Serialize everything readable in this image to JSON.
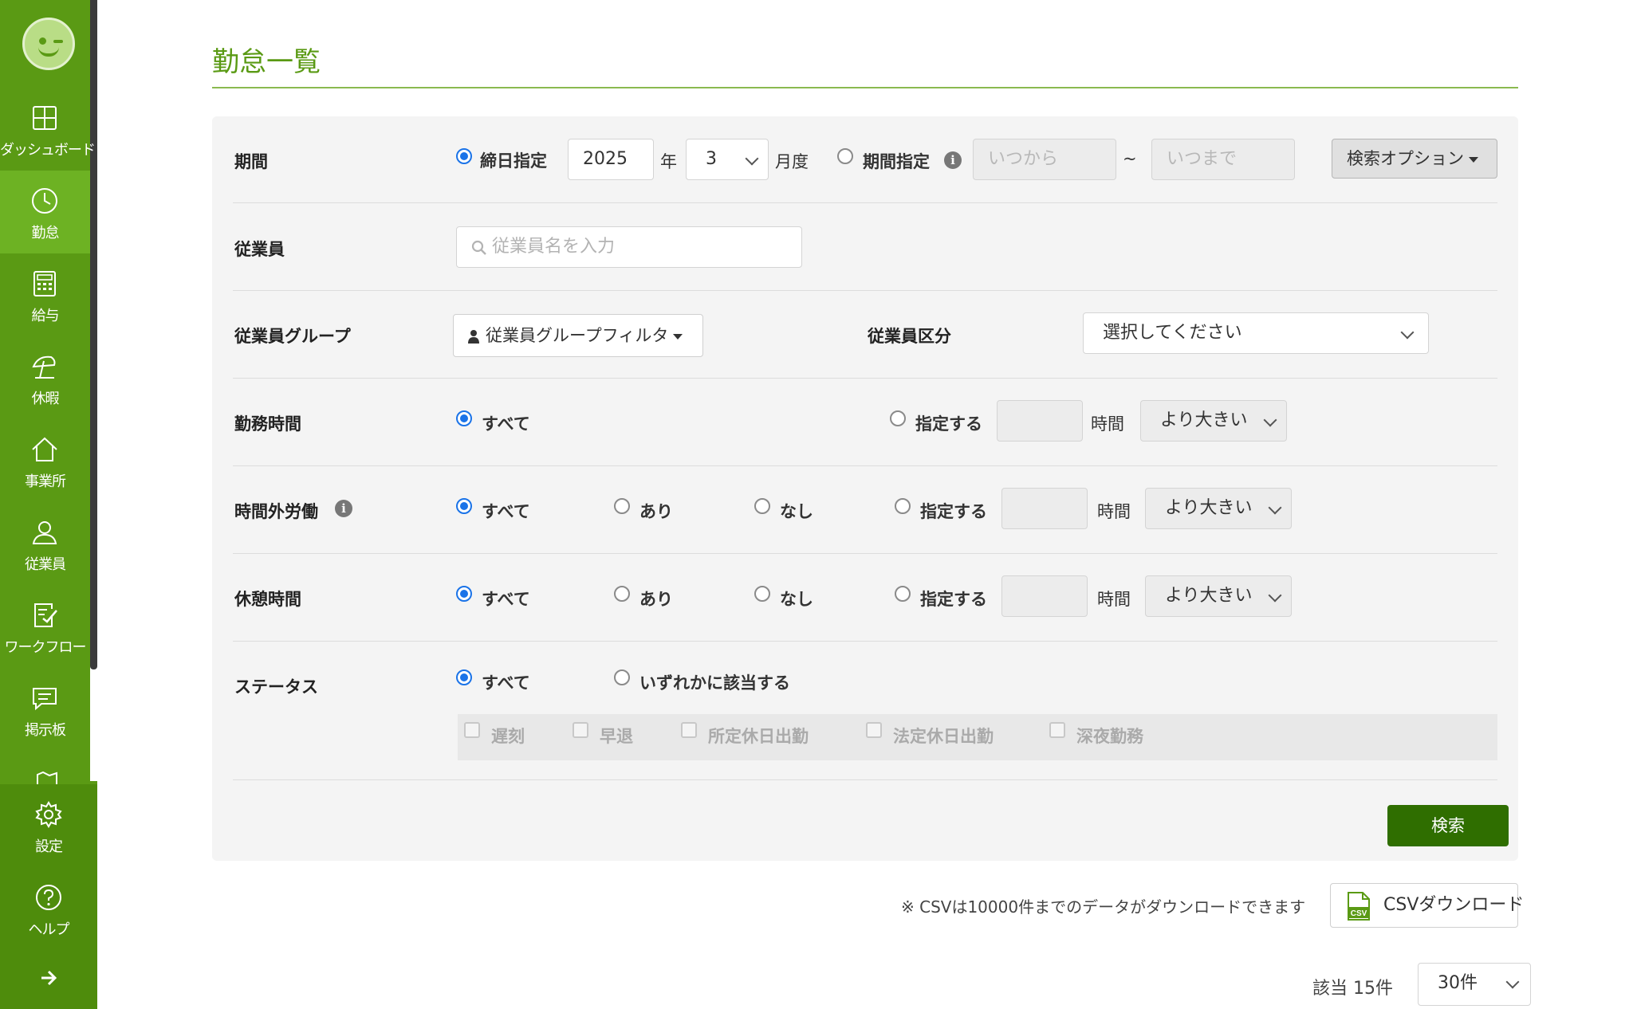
{
  "sidebar": {
    "items": [
      {
        "label": "ダッシュボード",
        "icon": "dashboard-icon"
      },
      {
        "label": "勤怠",
        "icon": "clock-icon"
      },
      {
        "label": "給与",
        "icon": "calculator-icon"
      },
      {
        "label": "休暇",
        "icon": "beach-umbrella-icon"
      },
      {
        "label": "事業所",
        "icon": "home-icon"
      },
      {
        "label": "従業員",
        "icon": "person-icon"
      },
      {
        "label": "ワークフロー",
        "icon": "workflow-check-icon"
      },
      {
        "label": "掲示板",
        "icon": "message-board-icon"
      }
    ],
    "bottom": [
      {
        "label": "設定",
        "icon": "gear-icon"
      },
      {
        "label": "ヘルプ",
        "icon": "help-icon"
      }
    ],
    "active_color": "#6db223",
    "bg_color": "#5a9a14"
  },
  "page": {
    "title": "勤怠一覧"
  },
  "filters": {
    "period": {
      "label": "期間",
      "closing_label": "締日指定",
      "year_value": "2025",
      "year_unit": "年",
      "month_value": "3",
      "month_unit": "月度",
      "range_label": "期間指定",
      "from_placeholder": "いつから",
      "tilde": "~",
      "to_placeholder": "いつまで",
      "options_button": "検索オプション"
    },
    "employee": {
      "label": "従業員",
      "placeholder": "従業員名を入力"
    },
    "group": {
      "label": "従業員グループ",
      "button": "従業員グループフィルタ",
      "category_label": "従業員区分",
      "category_value": "選択してください"
    },
    "work_hours": {
      "label": "勤務時間",
      "all": "すべて",
      "specify": "指定する",
      "unit": "時間",
      "comparator": "より大きい"
    },
    "overtime": {
      "label": "時間外労働",
      "all": "すべて",
      "yes": "あり",
      "no": "なし",
      "specify": "指定する",
      "unit": "時間",
      "comparator": "より大きい"
    },
    "break": {
      "label": "休憩時間",
      "all": "すべて",
      "yes": "あり",
      "no": "なし",
      "specify": "指定する",
      "unit": "時間",
      "comparator": "より大きい"
    },
    "status": {
      "label": "ステータス",
      "all": "すべて",
      "any": "いずれかに該当する",
      "checks": [
        "遅刻",
        "早退",
        "所定休日出勤",
        "法定休日出勤",
        "深夜勤務"
      ]
    },
    "search_button": "検索"
  },
  "csv": {
    "note": "※ CSVは10000件までのデータがダウンロードできます",
    "button": "CSVダウンロード",
    "file_icon_text": "CSV"
  },
  "results": {
    "count": "該当 15件",
    "per_page": "30件"
  }
}
